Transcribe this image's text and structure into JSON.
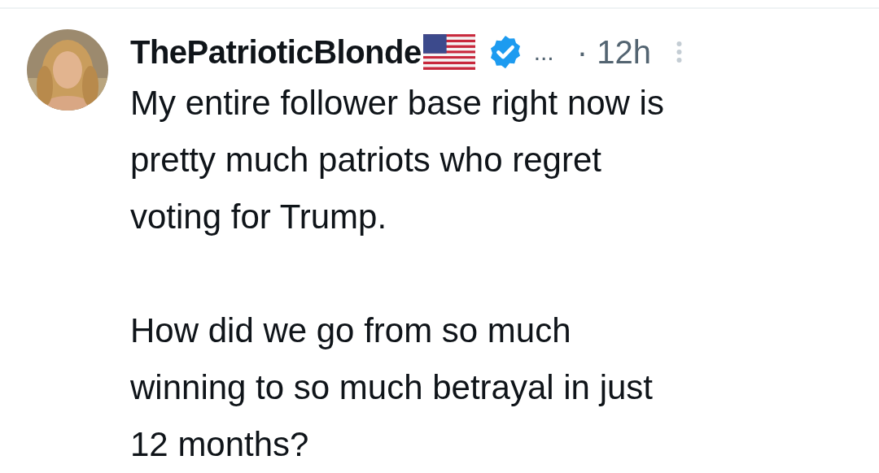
{
  "post": {
    "author": "ThePatrioticBlonde",
    "verified": true,
    "ellipsis": "...",
    "time": "· 12h",
    "paragraphs": [
      "My entire follower base right now is\npretty much patriots who regret\nvoting for Trump.",
      "How did we go from so much\nwinning to so much betrayal in just\n12 months?"
    ]
  }
}
